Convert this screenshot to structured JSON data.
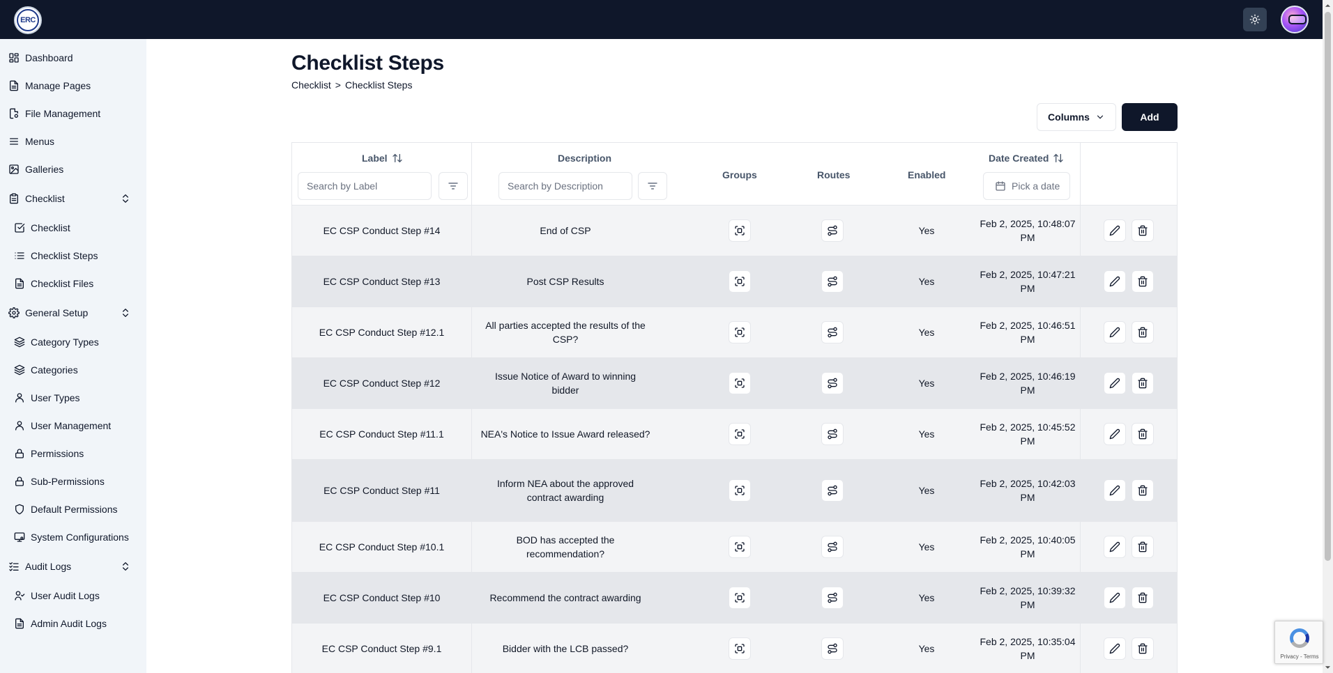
{
  "header": {
    "logo_text": "ERC",
    "theme_toggle": "sun-icon",
    "avatar": "user-avatar"
  },
  "sidebar": {
    "items": [
      {
        "label": "Dashboard",
        "icon": "dashboard-icon"
      },
      {
        "label": "Manage Pages",
        "icon": "file-icon"
      },
      {
        "label": "File Management",
        "icon": "file-cog-icon"
      },
      {
        "label": "Menus",
        "icon": "menu-icon"
      },
      {
        "label": "Galleries",
        "icon": "image-icon"
      },
      {
        "label": "Checklist",
        "icon": "clipboard-icon",
        "expandable": true
      },
      {
        "label": "Checklist",
        "icon": "checkbox-icon"
      },
      {
        "label": "Checklist Steps",
        "icon": "list-icon"
      },
      {
        "label": "Checklist Files",
        "icon": "file-icon"
      },
      {
        "label": "General Setup",
        "icon": "gear-icon",
        "expandable": true
      },
      {
        "label": "Category Types",
        "icon": "layers-icon"
      },
      {
        "label": "Categories",
        "icon": "layers-icon"
      },
      {
        "label": "User Types",
        "icon": "user-icon"
      },
      {
        "label": "User Management",
        "icon": "user-icon"
      },
      {
        "label": "Permissions",
        "icon": "lock-icon"
      },
      {
        "label": "Sub-Permissions",
        "icon": "lock-icon"
      },
      {
        "label": "Default Permissions",
        "icon": "shield-icon"
      },
      {
        "label": "System Configurations",
        "icon": "monitor-cog-icon"
      },
      {
        "label": "Audit Logs",
        "icon": "list-checks-icon",
        "expandable": true
      },
      {
        "label": "User Audit Logs",
        "icon": "user-check-icon"
      },
      {
        "label": "Admin Audit Logs",
        "icon": "file-icon"
      }
    ]
  },
  "page": {
    "title": "Checklist Steps",
    "breadcrumb": [
      "Checklist",
      ">",
      "Checklist Steps"
    ]
  },
  "toolbar": {
    "columns_label": "Columns",
    "add_label": "Add"
  },
  "table": {
    "columns": {
      "label": "Label",
      "description": "Description",
      "groups": "Groups",
      "routes": "Routes",
      "enabled": "Enabled",
      "date_created": "Date Created"
    },
    "filters": {
      "label_placeholder": "Search by Label",
      "description_placeholder": "Search by Description",
      "date_placeholder": "Pick a date"
    },
    "rows": [
      {
        "label": "EC CSP Conduct Step #14",
        "description": "End of CSP",
        "enabled": "Yes",
        "date_line1": "Feb 2, 2025, 10:48:07",
        "date_line2": "PM"
      },
      {
        "label": "EC CSP Conduct Step #13",
        "description": "Post CSP Results",
        "enabled": "Yes",
        "date_line1": "Feb 2, 2025, 10:47:21",
        "date_line2": "PM"
      },
      {
        "label": "EC CSP Conduct Step #12.1",
        "description": "All parties accepted the results of the CSP?",
        "enabled": "Yes",
        "date_line1": "Feb 2, 2025, 10:46:51",
        "date_line2": "PM"
      },
      {
        "label": "EC CSP Conduct Step #12",
        "description": "Issue Notice of Award  to winning bidder",
        "enabled": "Yes",
        "date_line1": "Feb 2, 2025, 10:46:19",
        "date_line2": "PM"
      },
      {
        "label": "EC CSP Conduct Step #11.1",
        "description": "NEA's Notice to Issue Award released?",
        "enabled": "Yes",
        "date_line1": "Feb 2, 2025, 10:45:52",
        "date_line2": "PM"
      },
      {
        "label": "EC CSP Conduct Step #11",
        "description": "Inform NEA about the approved contract awarding",
        "enabled": "Yes",
        "date_line1": "Feb 2, 2025, 10:42:03",
        "date_line2": "PM"
      },
      {
        "label": "EC CSP Conduct Step #10.1",
        "description": "BOD has accepted the recommendation?",
        "enabled": "Yes",
        "date_line1": "Feb 2, 2025, 10:40:05",
        "date_line2": "PM"
      },
      {
        "label": "EC CSP Conduct Step #10",
        "description": "Recommend the contract awarding",
        "enabled": "Yes",
        "date_line1": "Feb 2, 2025, 10:39:32",
        "date_line2": "PM"
      },
      {
        "label": "EC CSP Conduct Step #9.1",
        "description": "Bidder with the LCB passed?",
        "enabled": "Yes",
        "date_line1": "Feb 2, 2025, 10:35:04",
        "date_line2": "PM"
      }
    ]
  },
  "recaptcha": {
    "text": "Privacy - Terms"
  },
  "colors": {
    "topbar": "#0f172a",
    "sidebar": "#f1f5f9",
    "primary_button": "#0f172a",
    "row_odd": "#f3f4f6",
    "row_even": "#e5e7eb"
  }
}
